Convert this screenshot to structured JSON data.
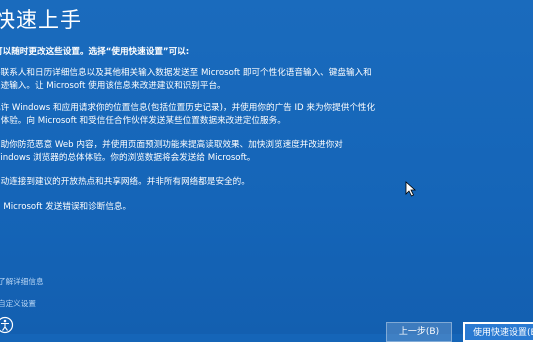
{
  "page": {
    "title": "快速上手",
    "intro": "可以随时更改这些设置。选择“使用快速设置”可以:",
    "paragraphs": [
      {
        "lines": [
          "将联系人和日历详细信息以及其他相关输入数据发送至 Microsoft 即可个性化语音输入、键盘输入和",
          "墨迹输入。让 Microsoft 使用该信息来改进建议和识别平台。"
        ]
      },
      {
        "lines": [
          "允许 Windows 和应用请求你的位置信息(包括位置历史记录)，并使用你的广告 ID 来为你提供个性化",
          "的体验。向 Microsoft 和受信任合作伙伴发送某些位置数据来改进定位服务。"
        ]
      },
      {
        "lines": [
          "帮助你防范恶意 Web 内容，并使用页面预测功能来提高读取效果、加快浏览速度并改进你对",
          "Windows 浏览器的总体体验。你的浏览数据将会发送给 Microsoft。"
        ]
      },
      {
        "lines": [
          "自动连接到建议的开放热点和共享网络。并非所有网络都是安全的。"
        ]
      },
      {
        "lines": [
          "向 Microsoft 发送错误和诊断信息。"
        ]
      }
    ],
    "links": {
      "details": "了解详细信息",
      "customize": "自定义设置"
    },
    "buttons": {
      "back": "上一步(B)",
      "express": "使用快速设置(E)"
    },
    "icons": {
      "ease_of_access": "ease-of-access-icon",
      "cursor": "mouse-cursor-icon"
    },
    "colors": {
      "background": "#1565b8",
      "link": "#b9d6f5",
      "text": "#ffffff"
    }
  }
}
